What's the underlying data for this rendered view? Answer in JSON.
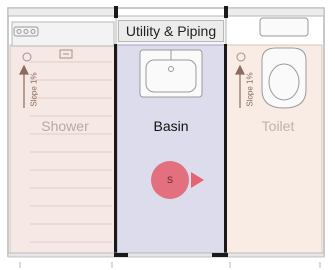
{
  "header": {
    "title": "Utility & Piping"
  },
  "rooms": {
    "shower": {
      "label": "Shower",
      "slope": "Slope 1%"
    },
    "basin": {
      "label": "Basin"
    },
    "toilet": {
      "label": "Toilet",
      "slope": "Slope 1%"
    }
  },
  "marker": {
    "label": "S"
  },
  "colors": {
    "shower_fill": "#f6e8e4",
    "basin_fill": "#dcdcec",
    "toilet_fill": "#f9ece4",
    "wall": "#1a1a1a",
    "marker": "#e36472",
    "fixture_stroke": "#9a9a9a"
  }
}
